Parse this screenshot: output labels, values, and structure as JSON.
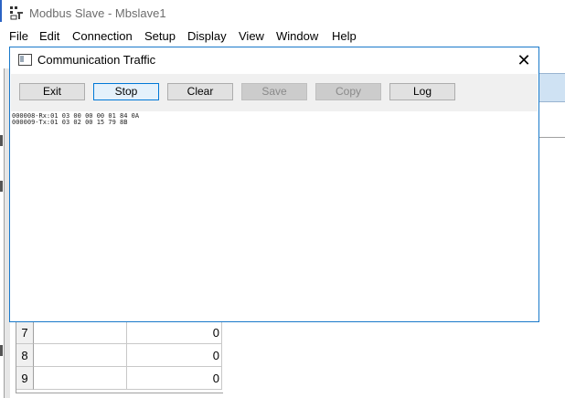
{
  "app": {
    "title": "Modbus Slave - Mbslave1",
    "icon": "modbus-app-icon"
  },
  "menu": {
    "items": [
      "File",
      "Edit",
      "Connection",
      "Setup",
      "Display",
      "View",
      "Window",
      "Help"
    ]
  },
  "grid": {
    "rows": [
      {
        "num": "7",
        "value": "0"
      },
      {
        "num": "8",
        "value": "0"
      },
      {
        "num": "9",
        "value": "0"
      }
    ]
  },
  "dialog": {
    "title": "Communication Traffic",
    "close_icon": "close-icon",
    "buttons": {
      "exit": "Exit",
      "stop": "Stop",
      "clear": "Clear",
      "save": "Save",
      "copy": "Copy",
      "log": "Log"
    },
    "traffic_lines": [
      "000008-Rx:01 03 00 00 00 01 84 0A",
      "000009-Tx:01 03 02 00 15 79 8B"
    ]
  },
  "colors": {
    "dialog_border": "#1979ca",
    "focused_button": "#0078d7",
    "disabled_button": "#cccccc"
  }
}
